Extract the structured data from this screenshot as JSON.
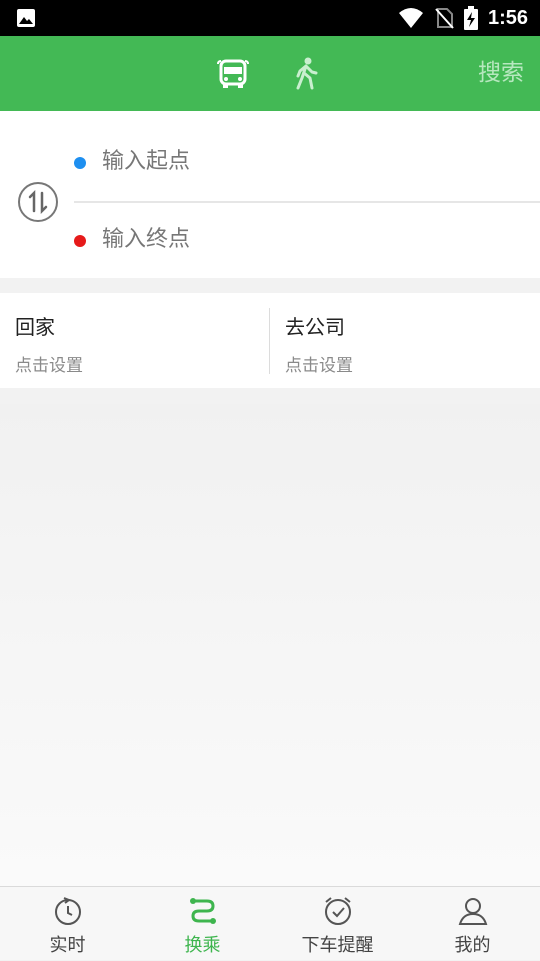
{
  "status_bar": {
    "time": "1:56"
  },
  "header": {
    "modes": [
      {
        "icon": "bus-icon"
      },
      {
        "icon": "walk-icon"
      }
    ],
    "search_label": "搜索",
    "accent_color": "#43b955"
  },
  "route": {
    "start_placeholder": "输入起点",
    "end_placeholder": "输入终点",
    "start_dot_color": "#1e8ff0",
    "end_dot_color": "#e61a1a"
  },
  "shortcuts": [
    {
      "title": "回家",
      "subtitle": "点击设置"
    },
    {
      "title": "去公司",
      "subtitle": "点击设置"
    }
  ],
  "bottom_nav": [
    {
      "label": "实时",
      "icon": "realtime-clock-icon",
      "active": false
    },
    {
      "label": "换乘",
      "icon": "transfer-route-icon",
      "active": true
    },
    {
      "label": "下车提醒",
      "icon": "alarm-clock-icon",
      "active": false
    },
    {
      "label": "我的",
      "icon": "user-icon",
      "active": false
    }
  ]
}
